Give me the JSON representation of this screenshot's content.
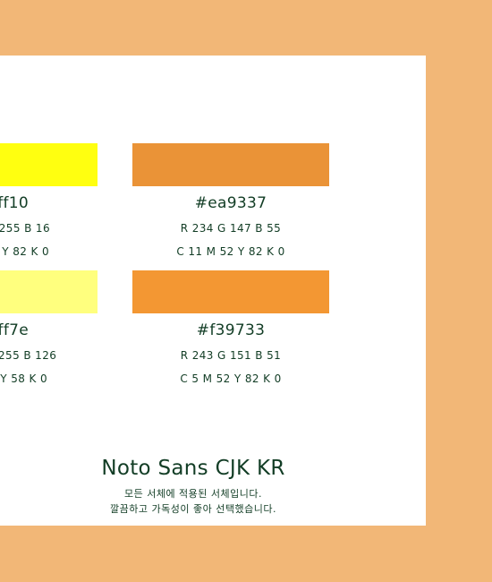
{
  "swatches": [
    {
      "hex": "ff10",
      "rgb": "255  B 16",
      "cmyk": "Y 82  K 0",
      "color": "#ffff10"
    },
    {
      "hex": "#ea9337",
      "rgb": "R 234  G 147  B 55",
      "cmyk": "C 11  M 52  Y 82  K 0",
      "color": "#ea9337"
    },
    {
      "hex": "ff7e",
      "rgb": "255  B 126",
      "cmyk": "Y 58  K 0",
      "color": "#ffff7e"
    },
    {
      "hex": "#f39733",
      "rgb": "R 243  G 151  B 51",
      "cmyk": "C 5  M 52  Y 82  K 0",
      "color": "#f39733"
    }
  ],
  "font_sample": {
    "name": "Noto Sans CJK KR",
    "line1": "모든 서체에 적용된 서체입니다.",
    "line2": "깔끔하고 가독성이 좋아 선택했습니다."
  },
  "colors": {
    "background": "#f2b777",
    "card": "#ffffff",
    "text": "#123d25"
  }
}
